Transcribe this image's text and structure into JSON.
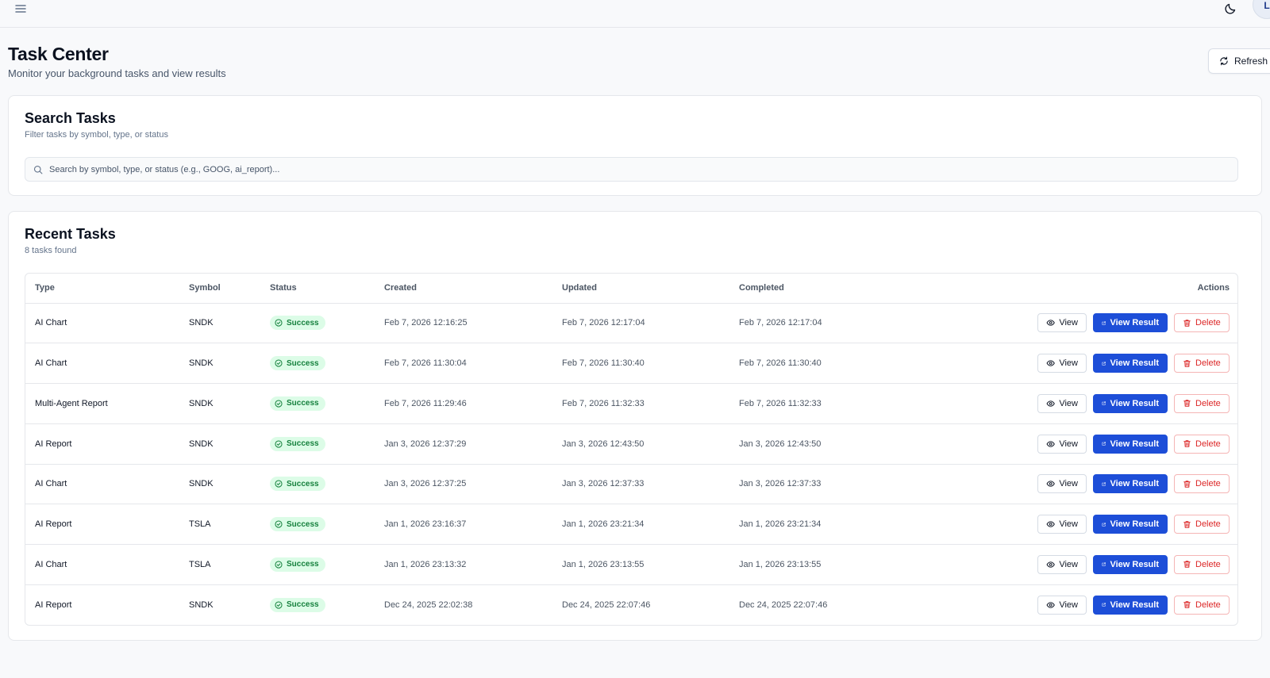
{
  "header": {
    "avatar_initial": "L"
  },
  "page": {
    "title": "Task Center",
    "subtitle": "Monitor your background tasks and view results",
    "refresh_label": "Refresh"
  },
  "search": {
    "title": "Search Tasks",
    "description": "Filter tasks by symbol, type, or status",
    "placeholder": "Search by symbol, type, or status (e.g., GOOG, ai_report)..."
  },
  "tasks": {
    "title": "Recent Tasks",
    "count_text": "8 tasks found",
    "columns": [
      "Type",
      "Symbol",
      "Status",
      "Created",
      "Updated",
      "Completed",
      "Actions"
    ],
    "action_labels": {
      "view": "View",
      "view_result": "View Result",
      "delete": "Delete"
    },
    "rows": [
      {
        "type": "AI Chart",
        "symbol": "SNDK",
        "status": "Success",
        "created": "Feb 7, 2026 12:16:25",
        "updated": "Feb 7, 2026 12:17:04",
        "completed": "Feb 7, 2026 12:17:04"
      },
      {
        "type": "AI Chart",
        "symbol": "SNDK",
        "status": "Success",
        "created": "Feb 7, 2026 11:30:04",
        "updated": "Feb 7, 2026 11:30:40",
        "completed": "Feb 7, 2026 11:30:40"
      },
      {
        "type": "Multi-Agent Report",
        "symbol": "SNDK",
        "status": "Success",
        "created": "Feb 7, 2026 11:29:46",
        "updated": "Feb 7, 2026 11:32:33",
        "completed": "Feb 7, 2026 11:32:33"
      },
      {
        "type": "AI Report",
        "symbol": "SNDK",
        "status": "Success",
        "created": "Jan 3, 2026 12:37:29",
        "updated": "Jan 3, 2026 12:43:50",
        "completed": "Jan 3, 2026 12:43:50"
      },
      {
        "type": "AI Chart",
        "symbol": "SNDK",
        "status": "Success",
        "created": "Jan 3, 2026 12:37:25",
        "updated": "Jan 3, 2026 12:37:33",
        "completed": "Jan 3, 2026 12:37:33"
      },
      {
        "type": "AI Report",
        "symbol": "TSLA",
        "status": "Success",
        "created": "Jan 1, 2026 23:16:37",
        "updated": "Jan 1, 2026 23:21:34",
        "completed": "Jan 1, 2026 23:21:34"
      },
      {
        "type": "AI Chart",
        "symbol": "TSLA",
        "status": "Success",
        "created": "Jan 1, 2026 23:13:32",
        "updated": "Jan 1, 2026 23:13:55",
        "completed": "Jan 1, 2026 23:13:55"
      },
      {
        "type": "AI Report",
        "symbol": "SNDK",
        "status": "Success",
        "created": "Dec 24, 2025 22:02:38",
        "updated": "Dec 24, 2025 22:07:46",
        "completed": "Dec 24, 2025 22:07:46"
      }
    ]
  },
  "icons": {
    "menu": "menu-icon",
    "theme": "moon-icon",
    "refresh": "refresh-icon",
    "search": "search-icon",
    "status_success": "check-circle-icon",
    "view": "eye-icon",
    "view_result": "external-link-icon",
    "delete": "trash-icon"
  },
  "colors": {
    "accent": "#1d4ed8",
    "success_bg": "#dcfce7",
    "success_text": "#15803d",
    "danger": "#dc2626"
  }
}
